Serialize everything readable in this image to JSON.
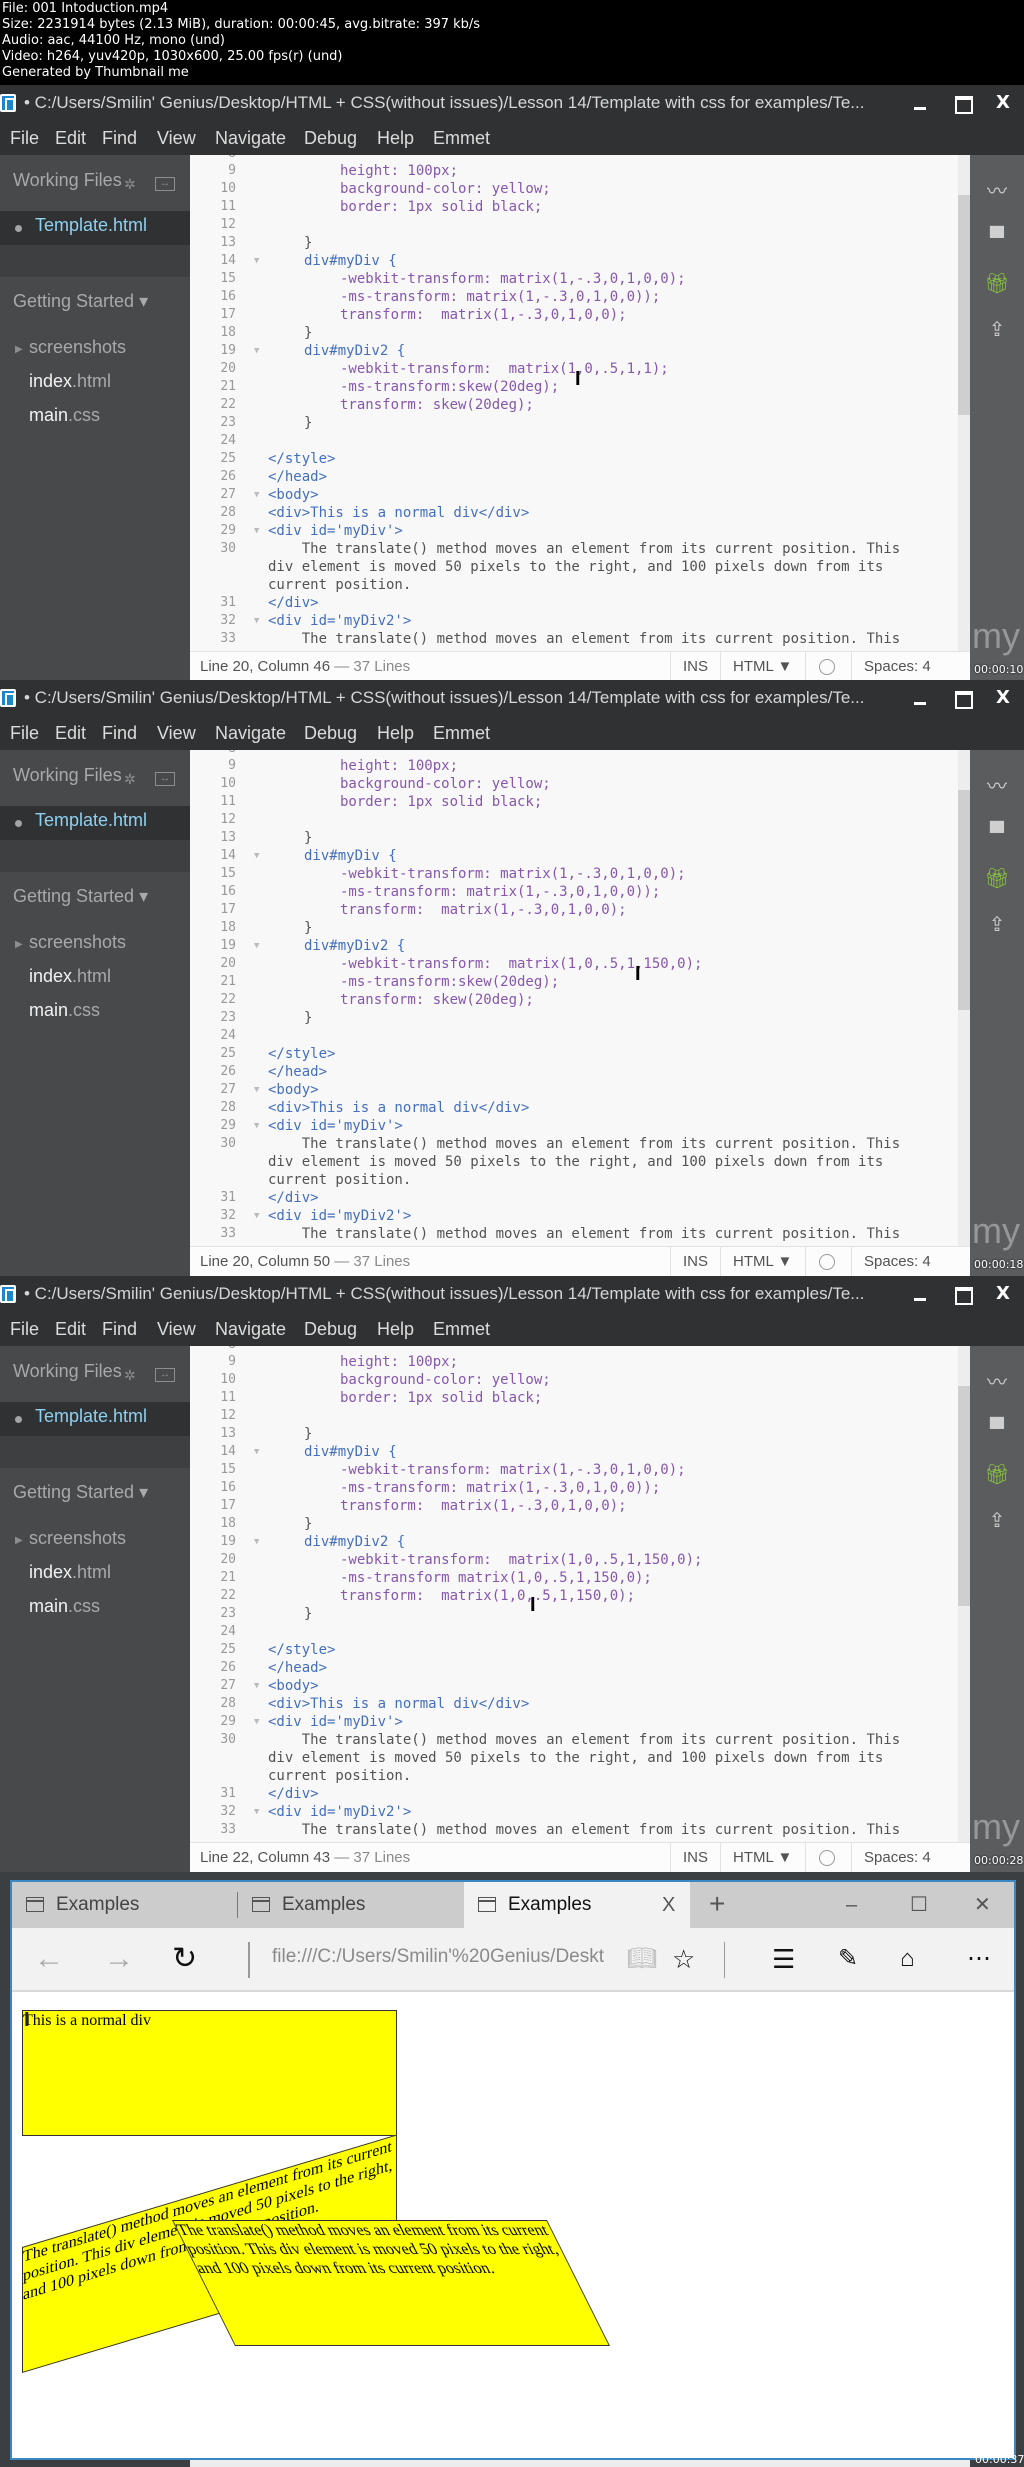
{
  "video_info": {
    "lines": [
      "File: 001 Intoduction.mp4",
      "Size: 2231914 bytes (2.13 MiB), duration: 00:00:45, avg.bitrate: 397 kb/s",
      "Audio: aac, 44100 Hz, mono (und)",
      "Video: h264, yuv420p, 1030x600, 25.00 fps(r) (und)",
      "Generated by Thumbnail me"
    ]
  },
  "editor_window": {
    "title": "• C:/Users/Smilin' Genius/Desktop/HTML + CSS(without issues)/Lesson 14/Template with css for examples/Te...",
    "close_glyph": "X",
    "menu": [
      "File",
      "Edit",
      "Find",
      "View",
      "Navigate",
      "Debug",
      "Help",
      "Emmet"
    ],
    "sidebar": {
      "working_files_label": "Working Files",
      "active_file": "Template.html",
      "project_label": "Getting Started ▾",
      "folder": "screenshots",
      "files": [
        {
          "base": "index",
          "ext": ".html"
        },
        {
          "base": "main",
          "ext": ".css"
        }
      ]
    },
    "right_tools": [
      "live-preview-icon",
      "extension-icon",
      "gift-icon",
      "layers-upload-icon"
    ],
    "watermark": "my",
    "common_code": {
      "line9": "height: 100px;",
      "line10": "background-color: yellow;",
      "line11": "border: 1px solid black;",
      "line13": "}",
      "line14": "div#myDiv {",
      "line15": "-webkit-transform: matrix(1,-.3,0,1,0,0);",
      "line16": "-ms-transform: matrix(1,-.3,0,1,0,0));",
      "line17": "transform:  matrix(1,-.3,0,1,0,0);",
      "line18": "}",
      "line19": "div#myDiv2 {",
      "line23": "}",
      "line25": "</style>",
      "line26": "</head>",
      "line27": "<body>",
      "line28": "<div>This is a normal div</div>",
      "line29": "<div id='myDiv'>",
      "line30a": "    The translate() method moves an element from its current position. This",
      "line30b": "div element is moved 50 pixels to the right, and 100 pixels down from its",
      "line30c": "current position.",
      "line31": "</div>",
      "line32": "<div id='myDiv2'>",
      "line33": "    The translate() method moves an element from its current position. This"
    },
    "status_common": {
      "lines_count": "— 37 Lines",
      "mode": "INS",
      "language": "HTML ▼",
      "spaces": "Spaces: 4"
    }
  },
  "frames": [
    {
      "line20": "-webkit-transform:  matrix(1,0,.5,1,1);",
      "line21": "-ms-transform:skew(20deg);",
      "line22": "transform: skew(20deg);",
      "cursor_position": "Line 20, Column 46",
      "timestamp": "00:00:10"
    },
    {
      "line20": "-webkit-transform:  matrix(1,0,.5,1,150,0);",
      "line21": "-ms-transform:skew(20deg);",
      "line22": "transform: skew(20deg);",
      "cursor_position": "Line 20, Column 50",
      "timestamp": "00:00:18"
    },
    {
      "line20": "-webkit-transform:  matrix(1,0,.5,1,150,0);",
      "line21": "-ms-transform matrix(1,0,.5,1,150,0);",
      "line22": "transform:  matrix(1,0,.5,1,150,0);",
      "cursor_position": "Line 22, Column 43",
      "timestamp": "00:00:28"
    }
  ],
  "browser": {
    "tabs": [
      {
        "label": "Examples",
        "active": false
      },
      {
        "label": "Examples",
        "active": false
      },
      {
        "label": "Examples",
        "active": true
      }
    ],
    "tab_close": "X",
    "new_tab": "+",
    "url": "file:///C:/Users/Smilin'%20Genius/Deskt",
    "page": {
      "normal_div_text": "This is a normal div",
      "mydiv_text": "The translate() method moves an element from its current position. This div element is moved 50 pixels to the right, and 100 pixels down from its current position.",
      "mydiv2_text": "The translate() method moves an element from its current position. This div element is moved 50 pixels to the right, and 100 pixels down from its current position."
    },
    "timestamp": "00:00:37"
  },
  "colors": {
    "editor_bg": "#f8f8f8",
    "chrome_dark": "#2f3133",
    "sidebar": "#47494b",
    "active_file": "#8fd0f0",
    "demo_yellow": "#ffff00",
    "browser_border": "#3a87c4"
  }
}
